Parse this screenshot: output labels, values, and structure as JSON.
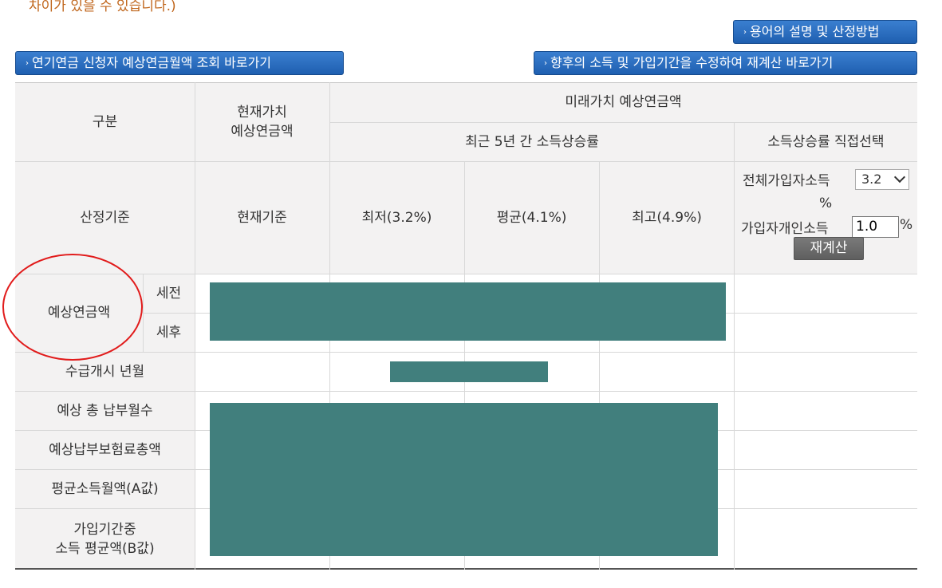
{
  "notice": "차이가 있을 수 있습니다.)",
  "buttons": {
    "terms": "용어의 설명 및 산정방법",
    "applicant_lookup": "연기연금 신청자 예상연금월액 조회 바로가기",
    "recalc_link": "향후의 소득 및 가입기간을 수정하여 재계산 바로가기",
    "arrow": "›"
  },
  "table": {
    "header": {
      "category": "구분",
      "present_value_line1": "현재가치",
      "present_value_line2": "예상연금액",
      "future_value": "미래가치 예상연금액",
      "recent_growth": "최근 5년 간 소득상승률",
      "direct_select": "소득상승률 직접선택"
    },
    "basis_row": {
      "label": "산정기준",
      "current": "현재기준",
      "low": "최저(3.2%)",
      "avg": "평균(4.1%)",
      "high": "최고(4.9%)"
    },
    "direct": {
      "all_income_label": "전체가입자소득",
      "all_income_value": "3.2",
      "percent": "%",
      "personal_income_label": "가입자개인소득",
      "personal_income_value": "1.0",
      "recalc_button": "재계산"
    },
    "rows": {
      "expected_pension": "예상연금액",
      "pre_tax": "세전",
      "post_tax": "세후",
      "start_date": "수급개시 년월",
      "total_months": "예상 총 납부월수",
      "total_premium": "예상납부보험료총액",
      "avg_income_a": "평균소득월액(A값)",
      "avg_income_b_line1": "가입기간중",
      "avg_income_b_line2": "소득 평균액(B값)"
    }
  },
  "colors": {
    "redaction": "#417f7d",
    "header_bg": "#f3f2f2",
    "button_blue": "#1f5fb0",
    "notice": "#c0661c",
    "annotation_circle": "#e11b1b"
  }
}
